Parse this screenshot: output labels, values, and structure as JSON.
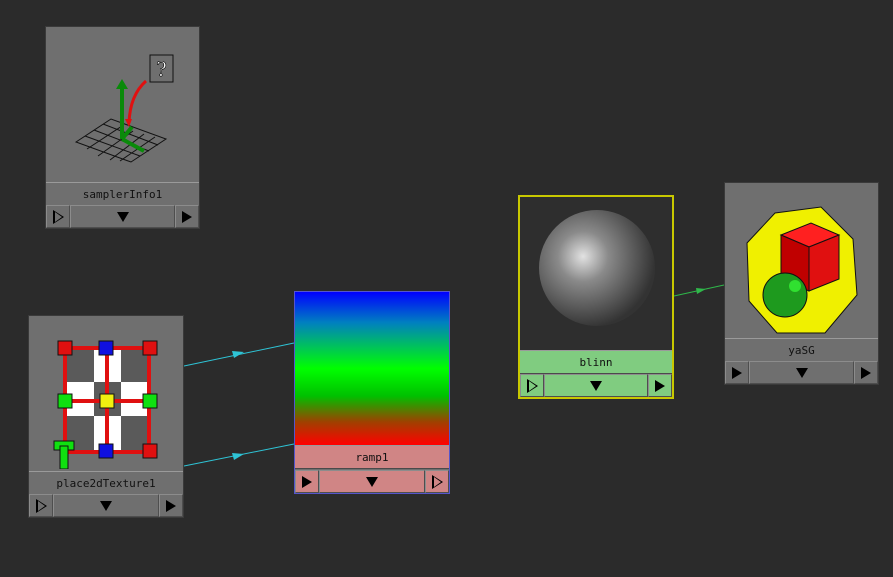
{
  "nodes": {
    "samplerInfo": {
      "label": "samplerInfo1",
      "icon": "sampler-info-axis-icon"
    },
    "place2dTexture": {
      "label": "place2dTexture1",
      "icon": "uv-placement-grid-icon"
    },
    "ramp": {
      "label": "ramp1",
      "icon": "ramp-gradient-swatch"
    },
    "blinn": {
      "label": "blinn",
      "icon": "shaded-sphere-swatch"
    },
    "yaSG": {
      "label": "yaSG",
      "icon": "shading-group-icon"
    }
  },
  "colors": {
    "background": "#2b2b2b",
    "node": "#6f6f6f",
    "connection_cyan": "#2ec4d6",
    "connection_green": "#2fb84a",
    "blinn_selected_border": "#c8c800",
    "blinn_label_bg": "#80cc80",
    "ramp_label_bg": "#d08585"
  },
  "port_glyphs": {
    "menu": "▼"
  }
}
